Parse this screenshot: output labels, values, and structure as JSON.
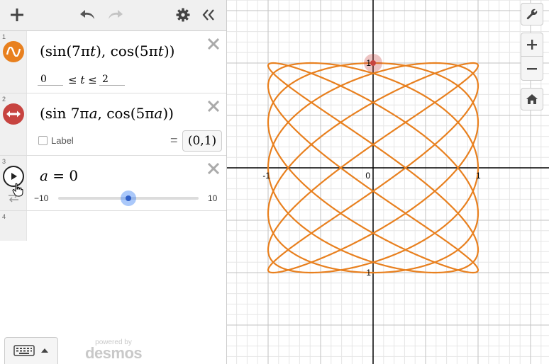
{
  "expressions": [
    {
      "number": "1",
      "icon": "parametric-curve-icon",
      "color": "#e8801f",
      "formula": {
        "open": "(sin(7π",
        "var1": "t",
        "mid": "), cos(5π",
        "var2": "t",
        "close": "))"
      },
      "domain": {
        "min": "0",
        "le1": "≤",
        "var": "t",
        "le2": "≤",
        "max": "2"
      }
    },
    {
      "number": "2",
      "icon": "movable-point-icon",
      "color": "#c74440",
      "formula": {
        "open": "(sin 7π",
        "var1": "a",
        "mid": ", cos(5π",
        "var2": "a",
        "close": "))"
      },
      "label_checkbox": "Label",
      "equals": "=",
      "value": "(0,1)"
    },
    {
      "number": "3",
      "icon": "play-icon",
      "formula": {
        "var": "a",
        "rest": " = 0"
      },
      "slider": {
        "min": "−10",
        "max": "10",
        "value": 0,
        "range": [
          -10,
          10
        ]
      }
    },
    {
      "number": "4"
    }
  ],
  "branding": {
    "powered_by": "powered by",
    "name": "desmos"
  },
  "graph": {
    "x_range": [
      -1.5,
      1.5
    ],
    "y_range": [
      -1.5,
      1.5
    ],
    "tick_labels": {
      "x_neg": "-1",
      "x_pos": "1",
      "origin": "0",
      "y_pos": "1",
      "y_neg": "1"
    },
    "curve": {
      "a": 7,
      "b": 5,
      "t_max": 2,
      "color": "#e8801f"
    },
    "point": {
      "x": 0,
      "y": 1,
      "color": "#c74440"
    },
    "grid_color_minor": "#e6e6e6",
    "grid_color_major": "#c2c2c2",
    "axis_color": "#000000"
  }
}
